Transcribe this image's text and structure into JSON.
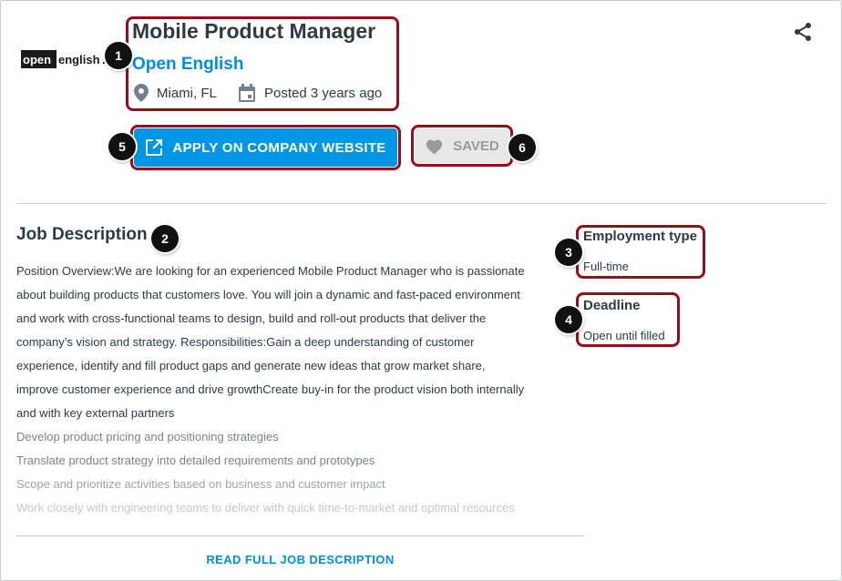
{
  "job": {
    "title": "Mobile Product Manager",
    "company": "Open English",
    "location": "Miami, FL",
    "posted": "Posted 3 years ago"
  },
  "logo": {
    "word_left": "open",
    "word_right": "english",
    "mark": "."
  },
  "actions": {
    "apply_label": "APPLY ON COMPANY WEBSITE",
    "saved_label": "SAVED"
  },
  "description": {
    "heading": "Job Description",
    "lines": [
      "Position Overview:We are looking for an experienced Mobile Product Manager who is passionate",
      "about building products that customers love. You will join a dynamic and fast-paced environment",
      "and work with cross-functional teams to design, build and roll-out products that deliver the",
      "company’s vision and strategy. Responsibilities:Gain a deep understanding of customer",
      "experience, identify and fill product gaps and generate new ideas that grow market share,",
      "improve customer experience and drive growthCreate buy-in for the product vision both internally",
      "and with key external partners",
      "Develop product pricing and positioning strategies",
      "Translate product strategy into detailed requirements and prototypes",
      "Scope and prioritize activities based on business and customer impact",
      "Work closely with engineering teams to deliver with quick time-to-market and optimal resources"
    ],
    "read_more": "READ FULL JOB DESCRIPTION"
  },
  "details": {
    "employment_type_label": "Employment type",
    "employment_type_value": "Full-time",
    "deadline_label": "Deadline",
    "deadline_value": "Open until filled"
  },
  "annotations": [
    "1",
    "2",
    "3",
    "4",
    "5",
    "6"
  ],
  "icons": {
    "location": "location-pin-icon",
    "calendar": "calendar-icon",
    "share": "share-icon",
    "external_link": "external-link-icon",
    "heart": "heart-icon"
  },
  "colors": {
    "link_blue": "#008ee2",
    "button_blue": "#0096e6",
    "callout_red": "#9b0b1a",
    "text": "#2d3b45"
  }
}
